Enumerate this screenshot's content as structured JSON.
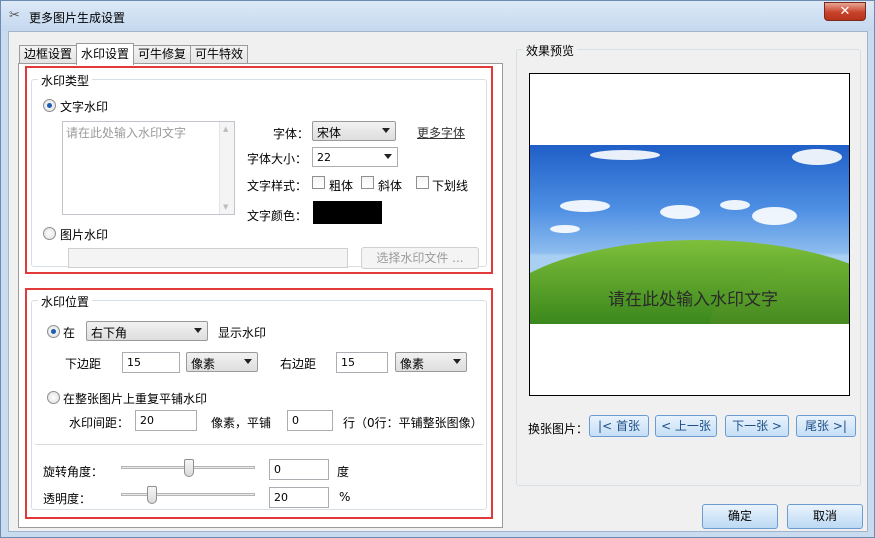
{
  "window": {
    "title": "更多图片生成设置",
    "close_glyph": "✕"
  },
  "tabs": [
    {
      "label": "边框设置"
    },
    {
      "label": "水印设置"
    },
    {
      "label": "可牛修复"
    },
    {
      "label": "可牛特效"
    }
  ],
  "watermark_type": {
    "legend": "水印类型",
    "text_radio": "文字水印",
    "text_placeholder": "请在此处输入水印文字",
    "font_label": "字体：",
    "font_value": "宋体",
    "more_fonts": "更多字体",
    "size_label": "字体大小：",
    "size_value": "22",
    "style_label": "文字样式：",
    "bold": "粗体",
    "italic": "斜体",
    "underline": "下划线",
    "color_label": "文字颜色：",
    "color_value": "#000000",
    "image_radio": "图片水印",
    "choose_file": "选择水印文件 ..."
  },
  "watermark_position": {
    "legend": "水印位置",
    "at_radio": "在",
    "position_value": "右下角",
    "show_label": "显示水印",
    "bottom_label": "下边距",
    "bottom_value": "15",
    "bottom_unit": "像素",
    "right_label": "右边距",
    "right_value": "15",
    "right_unit": "像素",
    "tile_radio": "在整张图片上重复平铺水印",
    "spacing_label": "水印间距：",
    "spacing_value": "20",
    "spacing_unit": "像素，平铺",
    "rows_value": "0",
    "rows_note": "行（0行：平铺整张图像）",
    "rotate_label": "旋转角度：",
    "rotate_value": "0",
    "rotate_unit": "度",
    "opacity_label": "透明度：",
    "opacity_value": "20",
    "opacity_unit": "%"
  },
  "preview": {
    "legend": "效果预览",
    "watermark_text": "请在此处输入水印文字",
    "switch_label": "换张图片：",
    "first": "|< 首张",
    "prev": "< 上一张",
    "next": "下一张 >",
    "last": "尾张 >|"
  },
  "dialog": {
    "ok": "确定",
    "cancel": "取消"
  },
  "colors": {
    "accent_red": "#e23a3a",
    "close_red": "#c7432a"
  }
}
